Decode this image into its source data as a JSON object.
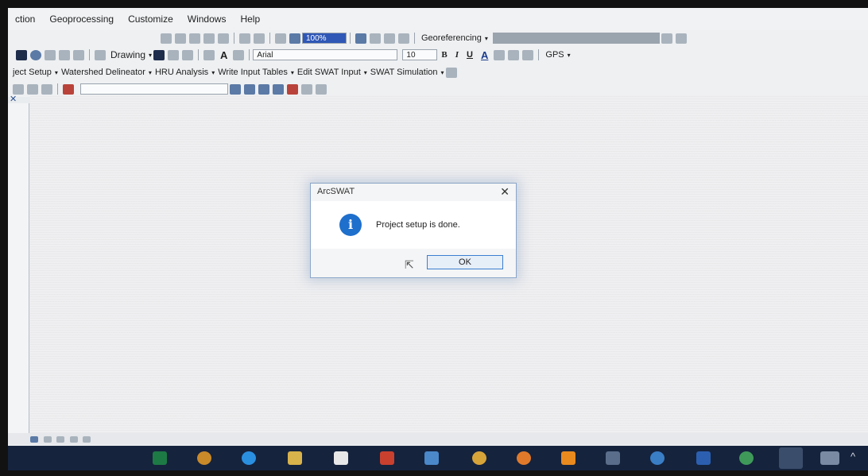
{
  "menu": [
    "ction",
    "Geoprocessing",
    "Customize",
    "Windows",
    "Help"
  ],
  "toolbar": {
    "zoom_value": "100%",
    "georeferencing_label": "Georeferencing",
    "drawing_label": "Drawing",
    "font_name": "Arial",
    "font_size": "10",
    "bold_label": "B",
    "italic_label": "I",
    "underline_label": "U",
    "font_color_label": "A",
    "text_tool_label": "A",
    "gps_label": "GPS"
  },
  "swat_toolbar": [
    "ject Setup",
    "Watershed Delineator",
    "HRU Analysis",
    "Write Input Tables",
    "Edit SWAT Input",
    "SWAT Simulation"
  ],
  "dialog": {
    "title": "ArcSWAT",
    "message": "Project setup is done.",
    "ok_label": "OK"
  },
  "colors": {
    "accent": "#1f6fcc",
    "taskbar": "#15233d"
  }
}
